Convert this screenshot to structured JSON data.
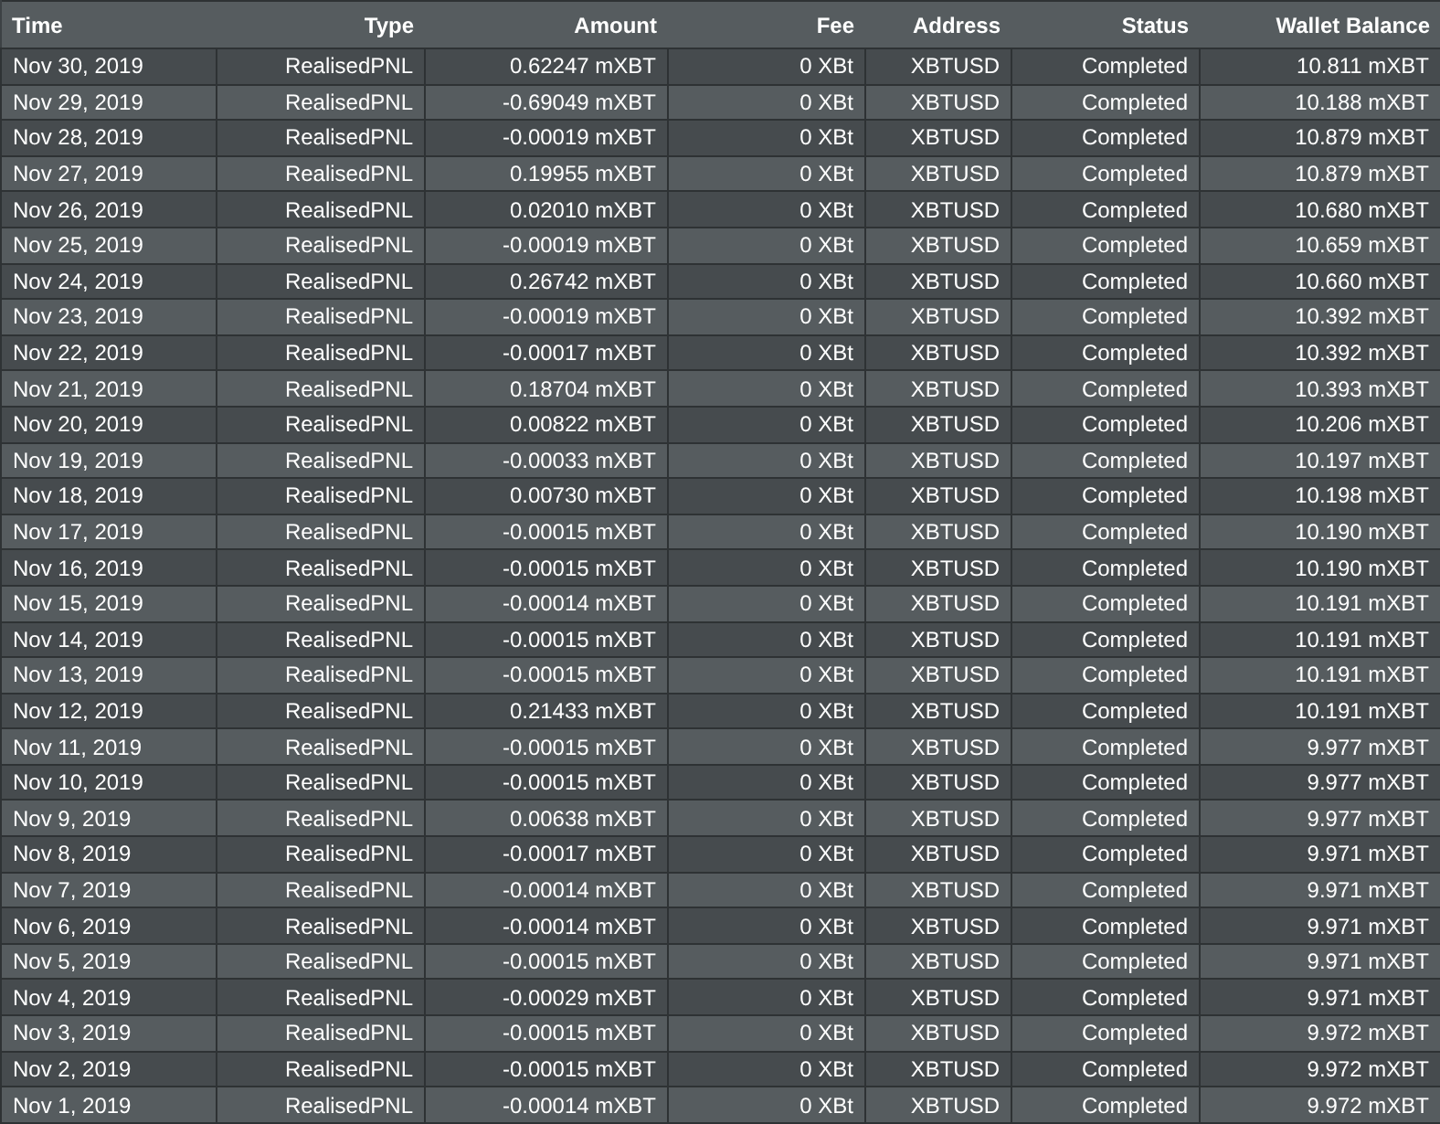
{
  "table": {
    "columns": [
      "Time",
      "Type",
      "Amount",
      "Fee",
      "Address",
      "Status",
      "Wallet Balance"
    ],
    "rows": [
      [
        "Nov 30, 2019",
        "RealisedPNL",
        "0.62247 mXBT",
        "0 XBt",
        "XBTUSD",
        "Completed",
        "10.811 mXBT"
      ],
      [
        "Nov 29, 2019",
        "RealisedPNL",
        "-0.69049 mXBT",
        "0 XBt",
        "XBTUSD",
        "Completed",
        "10.188 mXBT"
      ],
      [
        "Nov 28, 2019",
        "RealisedPNL",
        "-0.00019 mXBT",
        "0 XBt",
        "XBTUSD",
        "Completed",
        "10.879 mXBT"
      ],
      [
        "Nov 27, 2019",
        "RealisedPNL",
        "0.19955 mXBT",
        "0 XBt",
        "XBTUSD",
        "Completed",
        "10.879 mXBT"
      ],
      [
        "Nov 26, 2019",
        "RealisedPNL",
        "0.02010 mXBT",
        "0 XBt",
        "XBTUSD",
        "Completed",
        "10.680 mXBT"
      ],
      [
        "Nov 25, 2019",
        "RealisedPNL",
        "-0.00019 mXBT",
        "0 XBt",
        "XBTUSD",
        "Completed",
        "10.659 mXBT"
      ],
      [
        "Nov 24, 2019",
        "RealisedPNL",
        "0.26742 mXBT",
        "0 XBt",
        "XBTUSD",
        "Completed",
        "10.660 mXBT"
      ],
      [
        "Nov 23, 2019",
        "RealisedPNL",
        "-0.00019 mXBT",
        "0 XBt",
        "XBTUSD",
        "Completed",
        "10.392 mXBT"
      ],
      [
        "Nov 22, 2019",
        "RealisedPNL",
        "-0.00017 mXBT",
        "0 XBt",
        "XBTUSD",
        "Completed",
        "10.392 mXBT"
      ],
      [
        "Nov 21, 2019",
        "RealisedPNL",
        "0.18704 mXBT",
        "0 XBt",
        "XBTUSD",
        "Completed",
        "10.393 mXBT"
      ],
      [
        "Nov 20, 2019",
        "RealisedPNL",
        "0.00822 mXBT",
        "0 XBt",
        "XBTUSD",
        "Completed",
        "10.206 mXBT"
      ],
      [
        "Nov 19, 2019",
        "RealisedPNL",
        "-0.00033 mXBT",
        "0 XBt",
        "XBTUSD",
        "Completed",
        "10.197 mXBT"
      ],
      [
        "Nov 18, 2019",
        "RealisedPNL",
        "0.00730 mXBT",
        "0 XBt",
        "XBTUSD",
        "Completed",
        "10.198 mXBT"
      ],
      [
        "Nov 17, 2019",
        "RealisedPNL",
        "-0.00015 mXBT",
        "0 XBt",
        "XBTUSD",
        "Completed",
        "10.190 mXBT"
      ],
      [
        "Nov 16, 2019",
        "RealisedPNL",
        "-0.00015 mXBT",
        "0 XBt",
        "XBTUSD",
        "Completed",
        "10.190 mXBT"
      ],
      [
        "Nov 15, 2019",
        "RealisedPNL",
        "-0.00014 mXBT",
        "0 XBt",
        "XBTUSD",
        "Completed",
        "10.191 mXBT"
      ],
      [
        "Nov 14, 2019",
        "RealisedPNL",
        "-0.00015 mXBT",
        "0 XBt",
        "XBTUSD",
        "Completed",
        "10.191 mXBT"
      ],
      [
        "Nov 13, 2019",
        "RealisedPNL",
        "-0.00015 mXBT",
        "0 XBt",
        "XBTUSD",
        "Completed",
        "10.191 mXBT"
      ],
      [
        "Nov 12, 2019",
        "RealisedPNL",
        "0.21433 mXBT",
        "0 XBt",
        "XBTUSD",
        "Completed",
        "10.191 mXBT"
      ],
      [
        "Nov 11, 2019",
        "RealisedPNL",
        "-0.00015 mXBT",
        "0 XBt",
        "XBTUSD",
        "Completed",
        "9.977 mXBT"
      ],
      [
        "Nov 10, 2019",
        "RealisedPNL",
        "-0.00015 mXBT",
        "0 XBt",
        "XBTUSD",
        "Completed",
        "9.977 mXBT"
      ],
      [
        "Nov 9, 2019",
        "RealisedPNL",
        "0.00638 mXBT",
        "0 XBt",
        "XBTUSD",
        "Completed",
        "9.977 mXBT"
      ],
      [
        "Nov 8, 2019",
        "RealisedPNL",
        "-0.00017 mXBT",
        "0 XBt",
        "XBTUSD",
        "Completed",
        "9.971 mXBT"
      ],
      [
        "Nov 7, 2019",
        "RealisedPNL",
        "-0.00014 mXBT",
        "0 XBt",
        "XBTUSD",
        "Completed",
        "9.971 mXBT"
      ],
      [
        "Nov 6, 2019",
        "RealisedPNL",
        "-0.00014 mXBT",
        "0 XBt",
        "XBTUSD",
        "Completed",
        "9.971 mXBT"
      ],
      [
        "Nov 5, 2019",
        "RealisedPNL",
        "-0.00015 mXBT",
        "0 XBt",
        "XBTUSD",
        "Completed",
        "9.971 mXBT"
      ],
      [
        "Nov 4, 2019",
        "RealisedPNL",
        "-0.00029 mXBT",
        "0 XBt",
        "XBTUSD",
        "Completed",
        "9.971 mXBT"
      ],
      [
        "Nov 3, 2019",
        "RealisedPNL",
        "-0.00015 mXBT",
        "0 XBt",
        "XBTUSD",
        "Completed",
        "9.972 mXBT"
      ],
      [
        "Nov 2, 2019",
        "RealisedPNL",
        "-0.00015 mXBT",
        "0 XBt",
        "XBTUSD",
        "Completed",
        "9.972 mXBT"
      ],
      [
        "Nov 1, 2019",
        "RealisedPNL",
        "-0.00014 mXBT",
        "0 XBt",
        "XBTUSD",
        "Completed",
        "9.972 mXBT"
      ]
    ]
  }
}
